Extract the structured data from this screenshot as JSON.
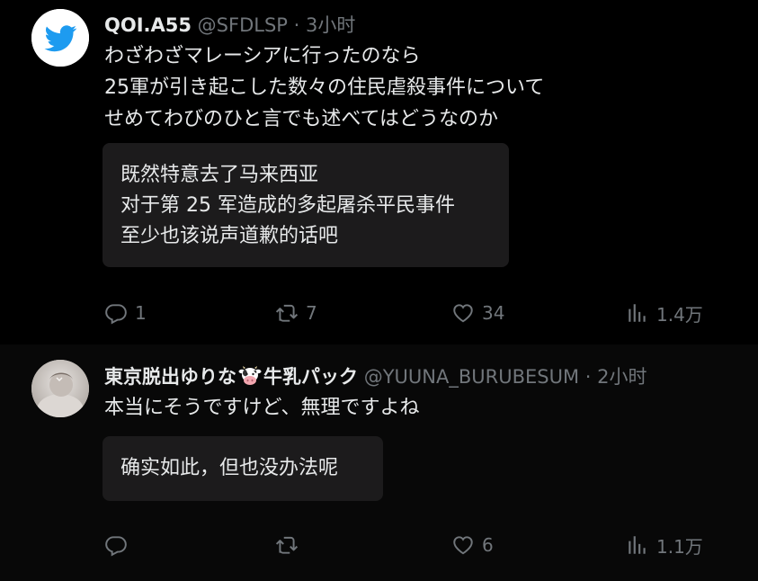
{
  "tweets": [
    {
      "author": {
        "name": "QOI.A55",
        "handle": "@SFDLSP"
      },
      "separator": "·",
      "time": "3小时",
      "text": "わざわざマレーシアに行ったのなら\n25軍が引き起こした数々の住民虐殺事件について\nせめてわびのひと言でも述べてはどうなのか",
      "translation": "既然特意去了马来西亚\n对于第 25 军造成的多起屠杀平民事件\n至少也该说声道歉的话吧",
      "stats": {
        "replies": "1",
        "retweets": "7",
        "likes": "34",
        "views": "1.4万"
      }
    },
    {
      "author": {
        "name_part1": "東京脱出ゆりな",
        "name_part2": "牛乳パック",
        "handle": "@YUUNA_BURUBESUM"
      },
      "separator": "·",
      "time": "2小时",
      "text": "本当にそうですけど、無理ですよね",
      "translation": "确实如此，但也没办法呢",
      "stats": {
        "replies": "",
        "retweets": "",
        "likes": "6",
        "views": "1.1万"
      }
    }
  ],
  "icons": {
    "avatar1": "twitter-bird-icon",
    "avatar2": "profile-photo",
    "reply": "reply-icon",
    "retweet": "retweet-icon",
    "like": "heart-icon",
    "views": "views-icon",
    "name_emoji": "cow-face-icon"
  },
  "colors": {
    "background": "#000000",
    "text": "#e7e9ea",
    "muted": "#71767b",
    "translation_bg": "#1c1b1c",
    "twitter_blue": "#1d9bf0"
  }
}
